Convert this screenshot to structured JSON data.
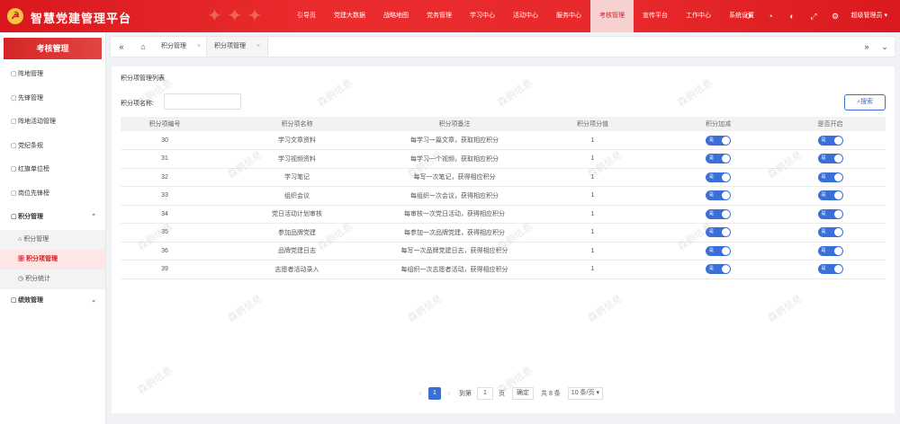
{
  "header": {
    "title": "智慧党建管理平台",
    "nav": [
      "引导页",
      "党建大数据",
      "战略地图",
      "党务管理",
      "学习中心",
      "活动中心",
      "服务中心",
      "考核管理",
      "宣传平台",
      "工作中心",
      "系统设置"
    ],
    "active_nav": "考核管理",
    "icons": [
      "refresh-icon",
      "bell-icon",
      "theme-icon",
      "fullscreen-icon",
      "settings-icon"
    ],
    "user": "超级管理员"
  },
  "sidebar": {
    "title": "考核管理",
    "items": [
      {
        "label": "阵地管理"
      },
      {
        "label": "先锋管理"
      },
      {
        "label": "阵地活动管理"
      },
      {
        "label": "党纪条规"
      },
      {
        "label": "红旗单位榜"
      },
      {
        "label": "岗位先锋榜"
      }
    ],
    "group": {
      "label": "积分管理",
      "children": [
        {
          "label": "积分管理"
        },
        {
          "label": "积分项管理"
        },
        {
          "label": "积分统计"
        }
      ]
    },
    "last": {
      "label": "绩效管理"
    }
  },
  "tabs": {
    "items": [
      "积分管理",
      "积分项管理"
    ]
  },
  "main": {
    "title": "积分项管理列表",
    "filter_label": "积分项名称:",
    "filter_value": "",
    "search_label": "搜索",
    "columns": [
      "积分项编号",
      "积分项名称",
      "积分项备注",
      "积分项分值",
      "积分加减",
      "是否开启"
    ],
    "toggle_label": "是",
    "rows": [
      {
        "id": "30",
        "name": "学习文章资料",
        "note": "每学习一篇文章，获取相应积分",
        "score": "1"
      },
      {
        "id": "31",
        "name": "学习视频资料",
        "note": "每学习一个视频，获取相应积分",
        "score": "1"
      },
      {
        "id": "32",
        "name": "学习笔记",
        "note": "每写一次笔记，获得相应积分",
        "score": "1"
      },
      {
        "id": "33",
        "name": "组织会议",
        "note": "每组织一次会议，获得相应积分",
        "score": "1"
      },
      {
        "id": "34",
        "name": "党日活动计划审核",
        "note": "每审核一次党日活动，获得相应积分",
        "score": "1"
      },
      {
        "id": "35",
        "name": "参加品牌党建",
        "note": "每参加一次品牌党建，获得相应积分",
        "score": "1"
      },
      {
        "id": "36",
        "name": "品牌党建日志",
        "note": "每写一次品牌党建日志，获得相应积分",
        "score": "1"
      },
      {
        "id": "39",
        "name": "志愿者活动录入",
        "note": "每组织一次志愿者活动，获得相应积分",
        "score": "1"
      }
    ]
  },
  "pagination": {
    "current": "1",
    "goto_label": "到第",
    "goto_value": "1",
    "page_unit": "页",
    "confirm": "确定",
    "total": "共 8 条",
    "page_size": "10 条/页"
  },
  "watermark": "森鹅信息"
}
